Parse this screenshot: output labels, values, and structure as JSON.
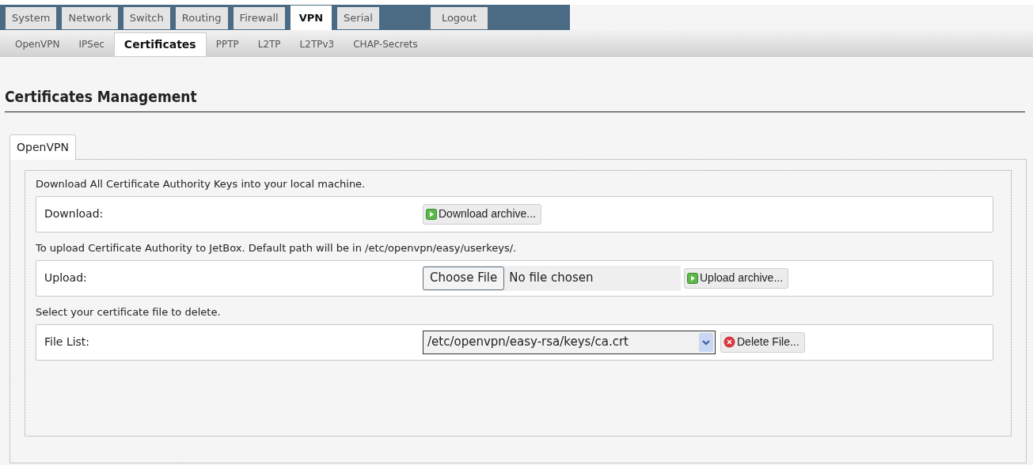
{
  "main_tabs": [
    {
      "label": "System",
      "selected": false
    },
    {
      "label": "Network",
      "selected": false
    },
    {
      "label": "Switch",
      "selected": false
    },
    {
      "label": "Routing",
      "selected": false
    },
    {
      "label": "Firewall",
      "selected": false
    },
    {
      "label": "VPN",
      "selected": true
    },
    {
      "label": "Serial",
      "selected": false
    }
  ],
  "logout": "Logout",
  "sub_tabs": [
    {
      "label": "OpenVPN",
      "selected": false
    },
    {
      "label": "IPSec",
      "selected": false
    },
    {
      "label": "Certificates",
      "selected": true
    },
    {
      "label": "PPTP",
      "selected": false
    },
    {
      "label": "L2TP",
      "selected": false
    },
    {
      "label": "L2TPv3",
      "selected": false
    },
    {
      "label": "CHAP-Secrets",
      "selected": false
    }
  ],
  "heading": "Certificates Management",
  "panel_tab": "OpenVPN",
  "sections": [
    {
      "kind": "download",
      "description": "Download All Certificate Authority Keys into your local machine.",
      "label": "Download:",
      "button": "Download archive..."
    },
    {
      "kind": "upload",
      "description": "To upload Certificate Authority to JetBox. Default path will be in /etc/openvpn/easy/userkeys/.",
      "label": "Upload:",
      "file_button": "Choose File",
      "file_status": "No file chosen",
      "button": "Upload archive..."
    },
    {
      "kind": "delete",
      "description": "Select your certificate file to delete.",
      "label": "File List:",
      "select_value": "/etc/openvpn/easy-rsa/keys/ca.crt",
      "button": "Delete File..."
    }
  ]
}
